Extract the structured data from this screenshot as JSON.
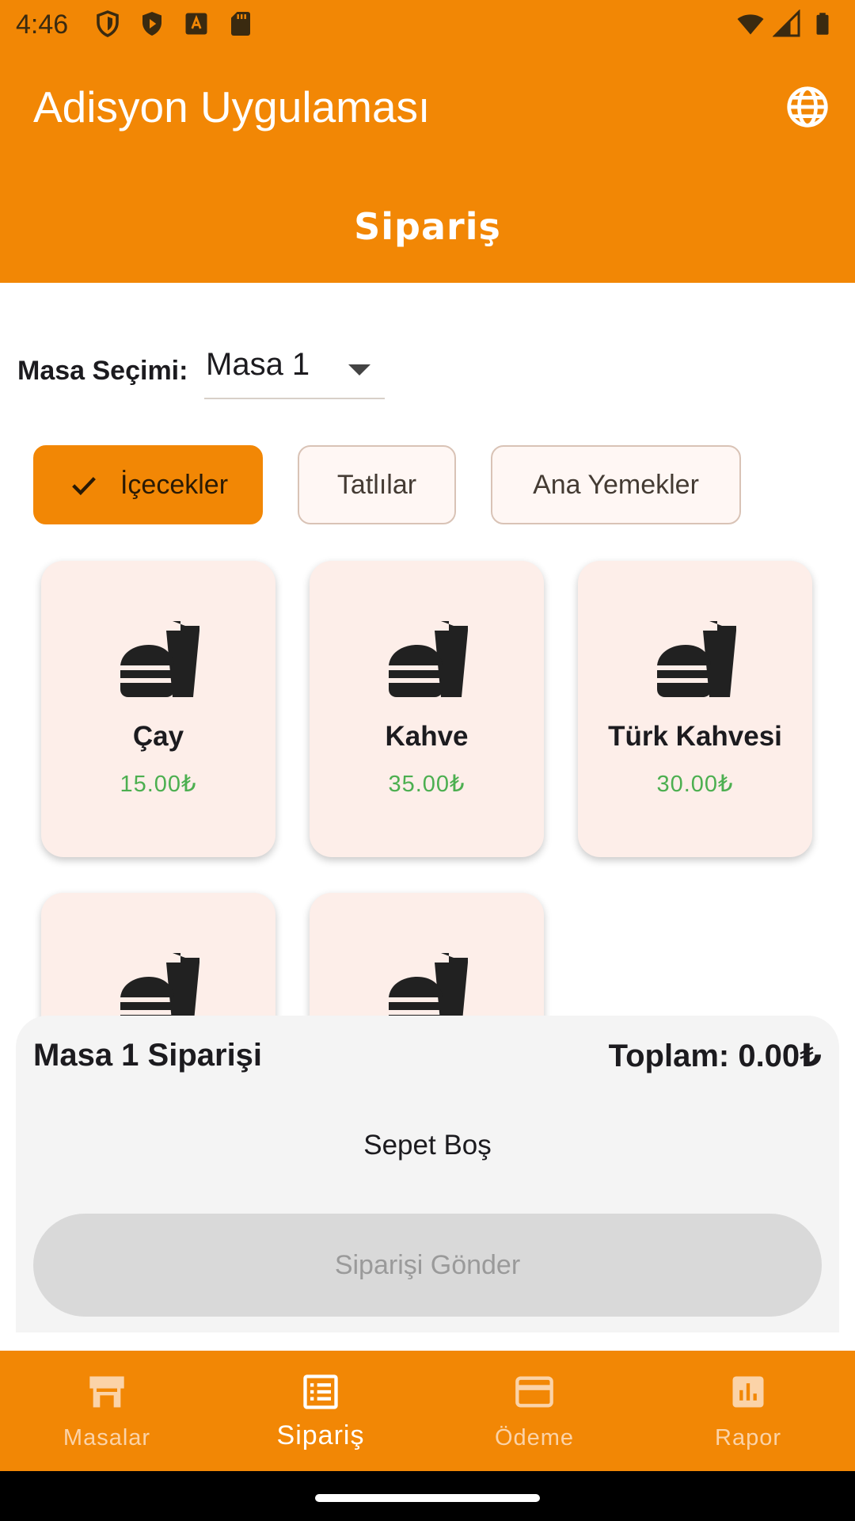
{
  "status_bar": {
    "time": "4:46"
  },
  "app_bar": {
    "title": "Adisyon Uygulaması",
    "page_title": "Sipariş"
  },
  "table_selection": {
    "label": "Masa Seçimi:",
    "value": "Masa 1"
  },
  "categories": [
    {
      "label": "İçecekler",
      "selected": true
    },
    {
      "label": "Tatlılar",
      "selected": false
    },
    {
      "label": "Ana Yemekler",
      "selected": false
    }
  ],
  "products": [
    {
      "name": "Çay",
      "price": "15.00₺"
    },
    {
      "name": "Kahve",
      "price": "35.00₺"
    },
    {
      "name": "Türk Kahvesi",
      "price": "30.00₺"
    }
  ],
  "order": {
    "title": "Masa 1 Siparişi",
    "total": "Toplam: 0.00₺",
    "empty_text": "Sepet Boş",
    "send_label": "Siparişi Gönder"
  },
  "bottom_nav": [
    {
      "label": "Masalar",
      "icon": "table-icon",
      "active": false
    },
    {
      "label": "Sipariş",
      "icon": "list-icon",
      "active": true
    },
    {
      "label": "Ödeme",
      "icon": "credit-card-icon",
      "active": false
    },
    {
      "label": "Rapor",
      "icon": "bar-chart-icon",
      "active": false
    }
  ],
  "colors": {
    "primary": "#F28705",
    "card_bg": "#fdeee9",
    "price": "#4caf50"
  }
}
